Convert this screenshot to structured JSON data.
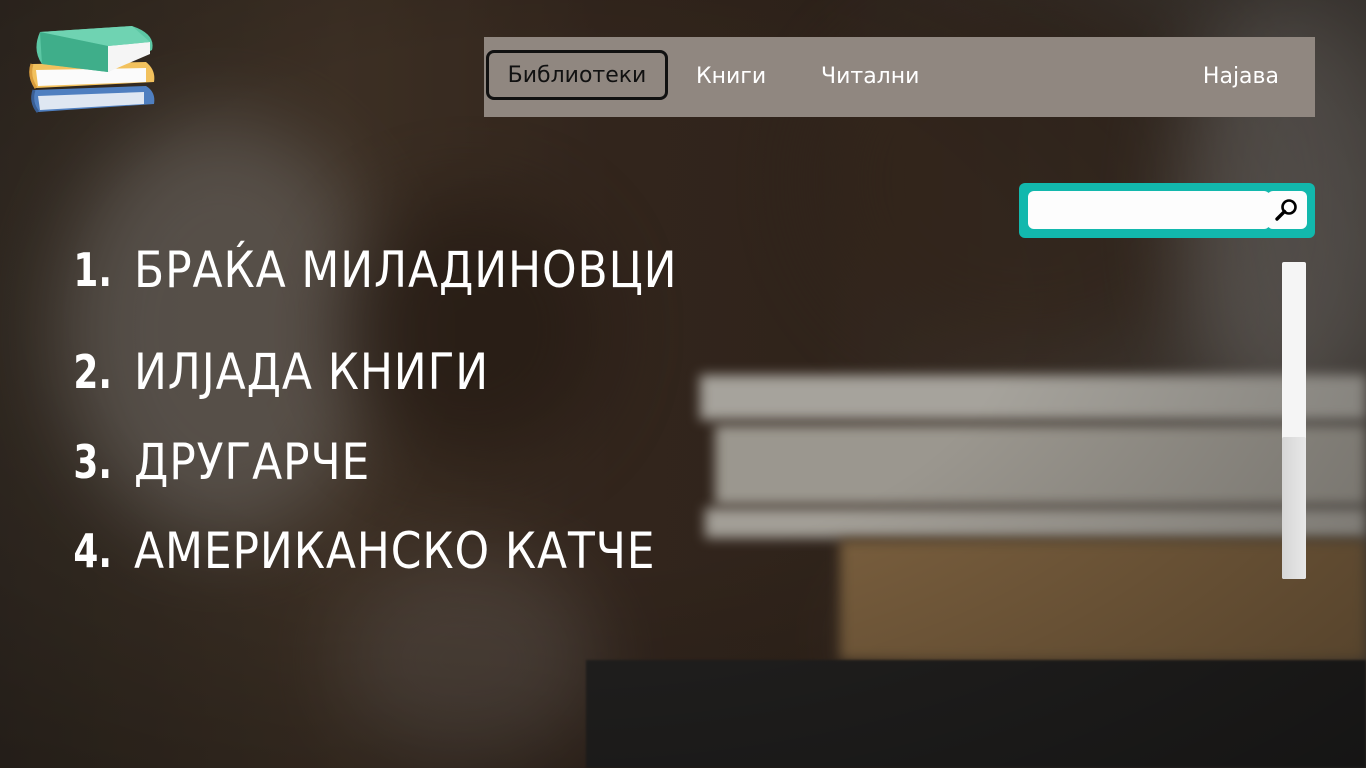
{
  "nav": {
    "items": [
      {
        "label": "Библиотеки",
        "active": true
      },
      {
        "label": "Книги"
      },
      {
        "label": "Читални"
      }
    ],
    "login_label": "Најава"
  },
  "search": {
    "placeholder": "",
    "value": ""
  },
  "list": [
    {
      "number": "1.",
      "title": "БРАЌА МИЛАДИНОВЦИ"
    },
    {
      "number": "2.",
      "title": "ИЛЈАДА КНИГИ"
    },
    {
      "number": "3.",
      "title": "ДРУГАРЧЕ"
    },
    {
      "number": "4.",
      "title": "АМЕРИКАНСКО КАТЧЕ"
    }
  ],
  "scrollbar": {
    "position_fraction": 0.55
  },
  "colors": {
    "nav_bg": "#908780",
    "search_bg": "#12b8ad",
    "text": "#ffffff",
    "active_border": "#111111"
  },
  "icons": {
    "logo": "books-stack-icon",
    "search": "magnifier-icon"
  }
}
